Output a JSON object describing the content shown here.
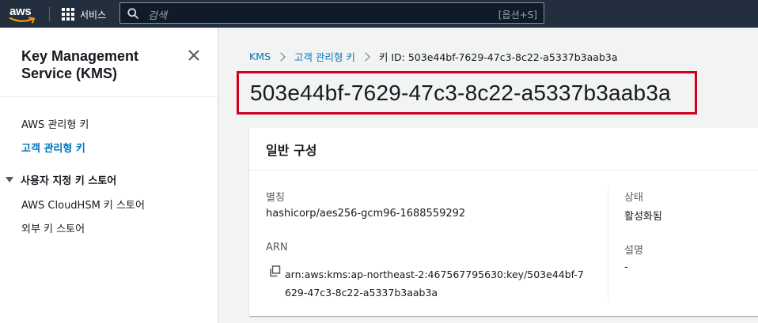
{
  "topnav": {
    "logo_text": "aws",
    "services_label": "서비스",
    "search_placeholder": "검색",
    "search_shortcut": "[옵션+S]"
  },
  "sidebar": {
    "title": "Key Management Service (KMS)",
    "items": [
      {
        "label": "AWS 관리형 키",
        "active": false
      },
      {
        "label": "고객 관리형 키",
        "active": true
      }
    ],
    "section": {
      "label": "사용자 지정 키 스토어",
      "items": [
        {
          "label": "AWS CloudHSM 키 스토어"
        },
        {
          "label": "외부 키 스토어"
        }
      ]
    }
  },
  "breadcrumb": {
    "items": [
      "KMS",
      "고객 관리형 키"
    ],
    "current": "키 ID: 503e44bf-7629-47c3-8c22-a5337b3aab3a"
  },
  "page_title": "503e44bf-7629-47c3-8c22-a5337b3aab3a",
  "highlight_color": "#d0021b",
  "general_config": {
    "header": "일반 구성",
    "alias_label": "별칭",
    "alias_value": "hashicorp/aes256-gcm96-1688559292",
    "arn_label": "ARN",
    "arn_value": "arn:aws:kms:ap-northeast-2:467567795630:key/503e44bf-7629-47c3-8c22-a5337b3aab3a",
    "status_label": "상태",
    "status_value": "활성화됨",
    "description_label": "설명",
    "description_value": "-"
  }
}
